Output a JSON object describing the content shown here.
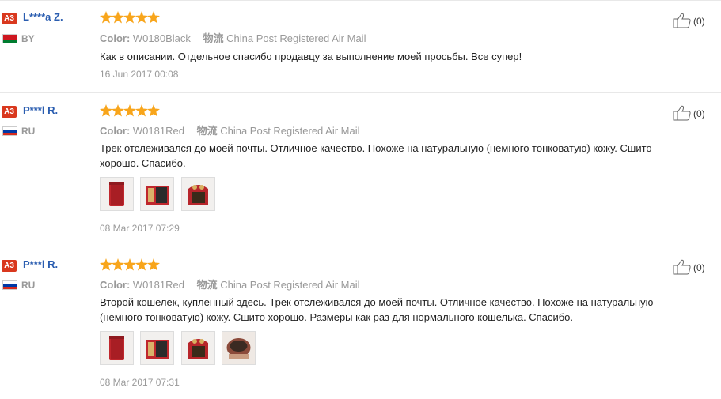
{
  "reviews": [
    {
      "badge": "A3",
      "name": "L****a Z.",
      "country": "BY",
      "flag_colors": [
        "#ce1720",
        "#ce1720",
        "#007c30"
      ],
      "rating": 5,
      "color_label": "Color:",
      "color_value": "W0180Black",
      "shipping_label": "物流",
      "shipping_value": "China Post Registered Air Mail",
      "text": "Как в описании. Отдельное спасибо продавцу за выполнение моей просьбы. Все супер!",
      "date": "16 Jun 2017 00:08",
      "likes": "(0)",
      "photos": []
    },
    {
      "badge": "A3",
      "name": "P***l R.",
      "country": "RU",
      "flag_colors": [
        "#ffffff",
        "#0039a6",
        "#d52b1e"
      ],
      "rating": 5,
      "color_label": "Color:",
      "color_value": "W0181Red",
      "shipping_label": "物流",
      "shipping_value": "China Post Registered Air Mail",
      "text": "Трек отслеживался до моей почты. Отличное качество. Похоже на натуральную (немного тонковатую) кожу. Сшито хорошо. Спасибо.",
      "date": "08 Mar 2017 07:29",
      "likes": "(0)",
      "photos": [
        "wallet-closed",
        "wallet-open",
        "wallet-clasp"
      ]
    },
    {
      "badge": "A3",
      "name": "P***l R.",
      "country": "RU",
      "flag_colors": [
        "#ffffff",
        "#0039a6",
        "#d52b1e"
      ],
      "rating": 5,
      "color_label": "Color:",
      "color_value": "W0181Red",
      "shipping_label": "物流",
      "shipping_value": "China Post Registered Air Mail",
      "text": "Второй кошелек, купленный здесь. Трек отслеживался до моей почты. Отличное качество. Похоже на натуральную (немного тонковатую) кожу. Сшито хорошо. Размеры как раз для нормального кошелька. Спасибо.",
      "date": "08 Mar 2017 07:31",
      "likes": "(0)",
      "photos": [
        "wallet-closed",
        "wallet-open",
        "wallet-clasp",
        "wallet-inside"
      ]
    }
  ],
  "colors": {
    "star": "#f8a51b",
    "name": "#2a5db0",
    "badge": "#d9381e",
    "meta": "#999999"
  }
}
